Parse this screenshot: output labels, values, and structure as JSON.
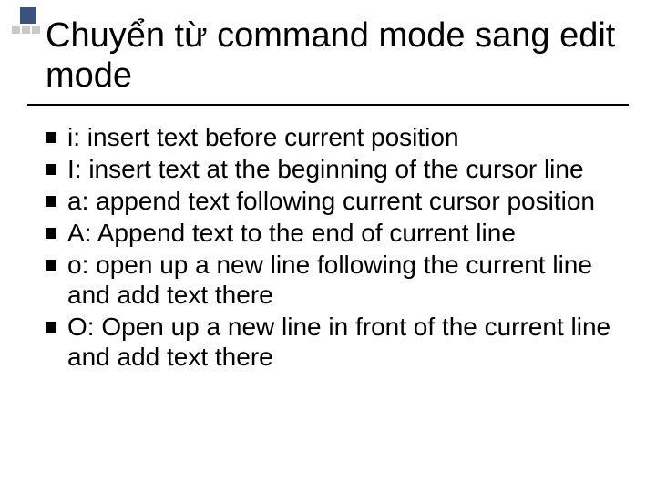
{
  "title": "Chuyển từ command mode sang edit mode",
  "bullets": [
    "i: insert text before current position",
    "I: insert text at the beginning of the cursor line",
    "a: append text following current cursor position",
    "A: Append text to the end of current line",
    "o: open up a new line following the current line and add text there",
    "O: Open up a new line in front of the current line and add text there"
  ]
}
